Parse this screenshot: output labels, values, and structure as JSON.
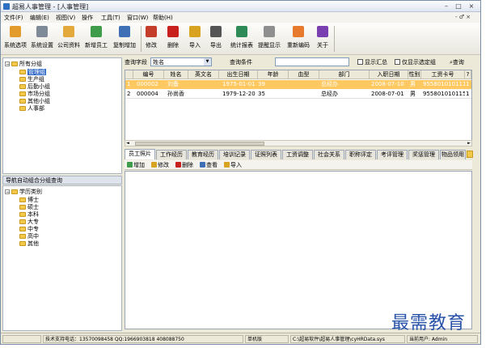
{
  "window": {
    "title": "超易人事管理 - [人事管理]",
    "min_label": "–",
    "max_label": "□",
    "close_label": "×"
  },
  "menu": {
    "items": [
      "文件(F)",
      "编辑(E)",
      "视图(V)",
      "操作",
      "工具(T)",
      "窗口(W)",
      "帮助(H)"
    ],
    "child_controls": "- ♂ ×"
  },
  "toolbar": {
    "buttons": [
      {
        "label": "系统选项",
        "icon": "settings-icon",
        "color": "#e39b2c"
      },
      {
        "label": "系统设置",
        "icon": "tools-icon",
        "color": "#7f8a98"
      },
      {
        "label": "公司资料",
        "icon": "folder-icon",
        "color": "#e3a93a"
      },
      {
        "label": "新增员工",
        "icon": "add-user-icon",
        "color": "#3e9c4a"
      },
      {
        "label": "复制增加",
        "icon": "copy-icon",
        "color": "#3f6fb5"
      },
      {
        "label": "修改",
        "icon": "edit-icon",
        "color": "#c43c2a"
      },
      {
        "label": "删除",
        "icon": "delete-icon",
        "color": "#c8201c"
      },
      {
        "label": "导入",
        "icon": "import-icon",
        "color": "#d9a322"
      },
      {
        "label": "导出",
        "icon": "export-icon",
        "color": "#555555"
      },
      {
        "label": "统计报表",
        "icon": "report-icon",
        "color": "#2e8b57"
      },
      {
        "label": "提醒显示",
        "icon": "reminder-icon",
        "color": "#8f8f8f"
      },
      {
        "label": "重新编码",
        "icon": "recode-icon",
        "color": "#e87a2e"
      },
      {
        "label": "关于",
        "icon": "help-icon",
        "color": "#7a3fb1"
      }
    ]
  },
  "tree": {
    "root": "所有分组",
    "items": [
      "管理组",
      "生产组",
      "后勤小组",
      "市场分组",
      "其他小组",
      "人事部"
    ],
    "selected": "管理组"
  },
  "section2": {
    "header": "导航自动组合分组查询",
    "root": "学历类别",
    "items": [
      "博士",
      "硕士",
      "本科",
      "大专",
      "中专",
      "高中",
      "其他"
    ]
  },
  "query": {
    "field_label": "查询字段",
    "field_value": "姓名",
    "cond_label": "查询条件",
    "cond_value": "",
    "show_summary": "显示汇总",
    "only_selected": "仅显示选定组",
    "search_button": "查询"
  },
  "grid": {
    "columns": [
      "编号",
      "姓名",
      "英文名",
      "出生日期",
      "年龄",
      "血型",
      "部门",
      "入职日期",
      "性别",
      "工资卡号",
      "?"
    ],
    "rows": [
      {
        "n": "1",
        "cells": [
          "000002",
          "刘备",
          "",
          "1975-01-01",
          "39",
          "",
          "总经办",
          "2008-07-10",
          "男",
          "955801010111",
          "1"
        ]
      },
      {
        "n": "2",
        "cells": [
          "000004",
          "孙尚香",
          "",
          "1979-12-20",
          "35",
          "",
          "总经办",
          "2008-07-01",
          "男",
          "955801010115",
          "1"
        ]
      }
    ]
  },
  "tabs": [
    "员工照片",
    "工作经历",
    "教育经历",
    "培训记录",
    "证照列表",
    "工资调整",
    "社会关系",
    "职称评定",
    "考评管理",
    "奖惩管理",
    "物品领用"
  ],
  "subtoolbar": [
    {
      "label": "增加",
      "icon": "add-icon",
      "color": "#3e9c4a"
    },
    {
      "label": "修改",
      "icon": "edit-icon",
      "color": "#d9a322"
    },
    {
      "label": "删除",
      "icon": "delete-icon",
      "color": "#c8201c"
    },
    {
      "label": "查看",
      "icon": "view-icon",
      "color": "#3f6fb5"
    },
    {
      "label": "导入",
      "icon": "import-icon",
      "color": "#d9a322"
    }
  ],
  "status": {
    "support": "技术支持电话：13570098458 QQ:1966903818 408088750",
    "mode": "单机版",
    "path": "C:\\超易软件\\超易人事管理\\cyHRData.sys",
    "user": "当前用户: Admin"
  },
  "watermark": "最需教育"
}
